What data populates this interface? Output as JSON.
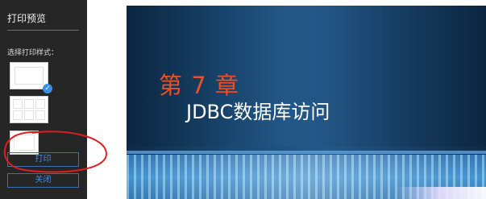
{
  "sidebar": {
    "title": "打印预览",
    "style_label": "选择打印样式：",
    "print_label": "打印",
    "close_label": "关闭"
  },
  "slide": {
    "chapter": "第 7 章",
    "title": "JDBC数据库访问"
  },
  "icons": {
    "selected_check": "check-icon"
  },
  "colors": {
    "sidebar_bg": "#262626",
    "accent_blue": "#4d88d6",
    "chapter_red": "#e8502a",
    "annotation_red": "#e01e1e"
  }
}
